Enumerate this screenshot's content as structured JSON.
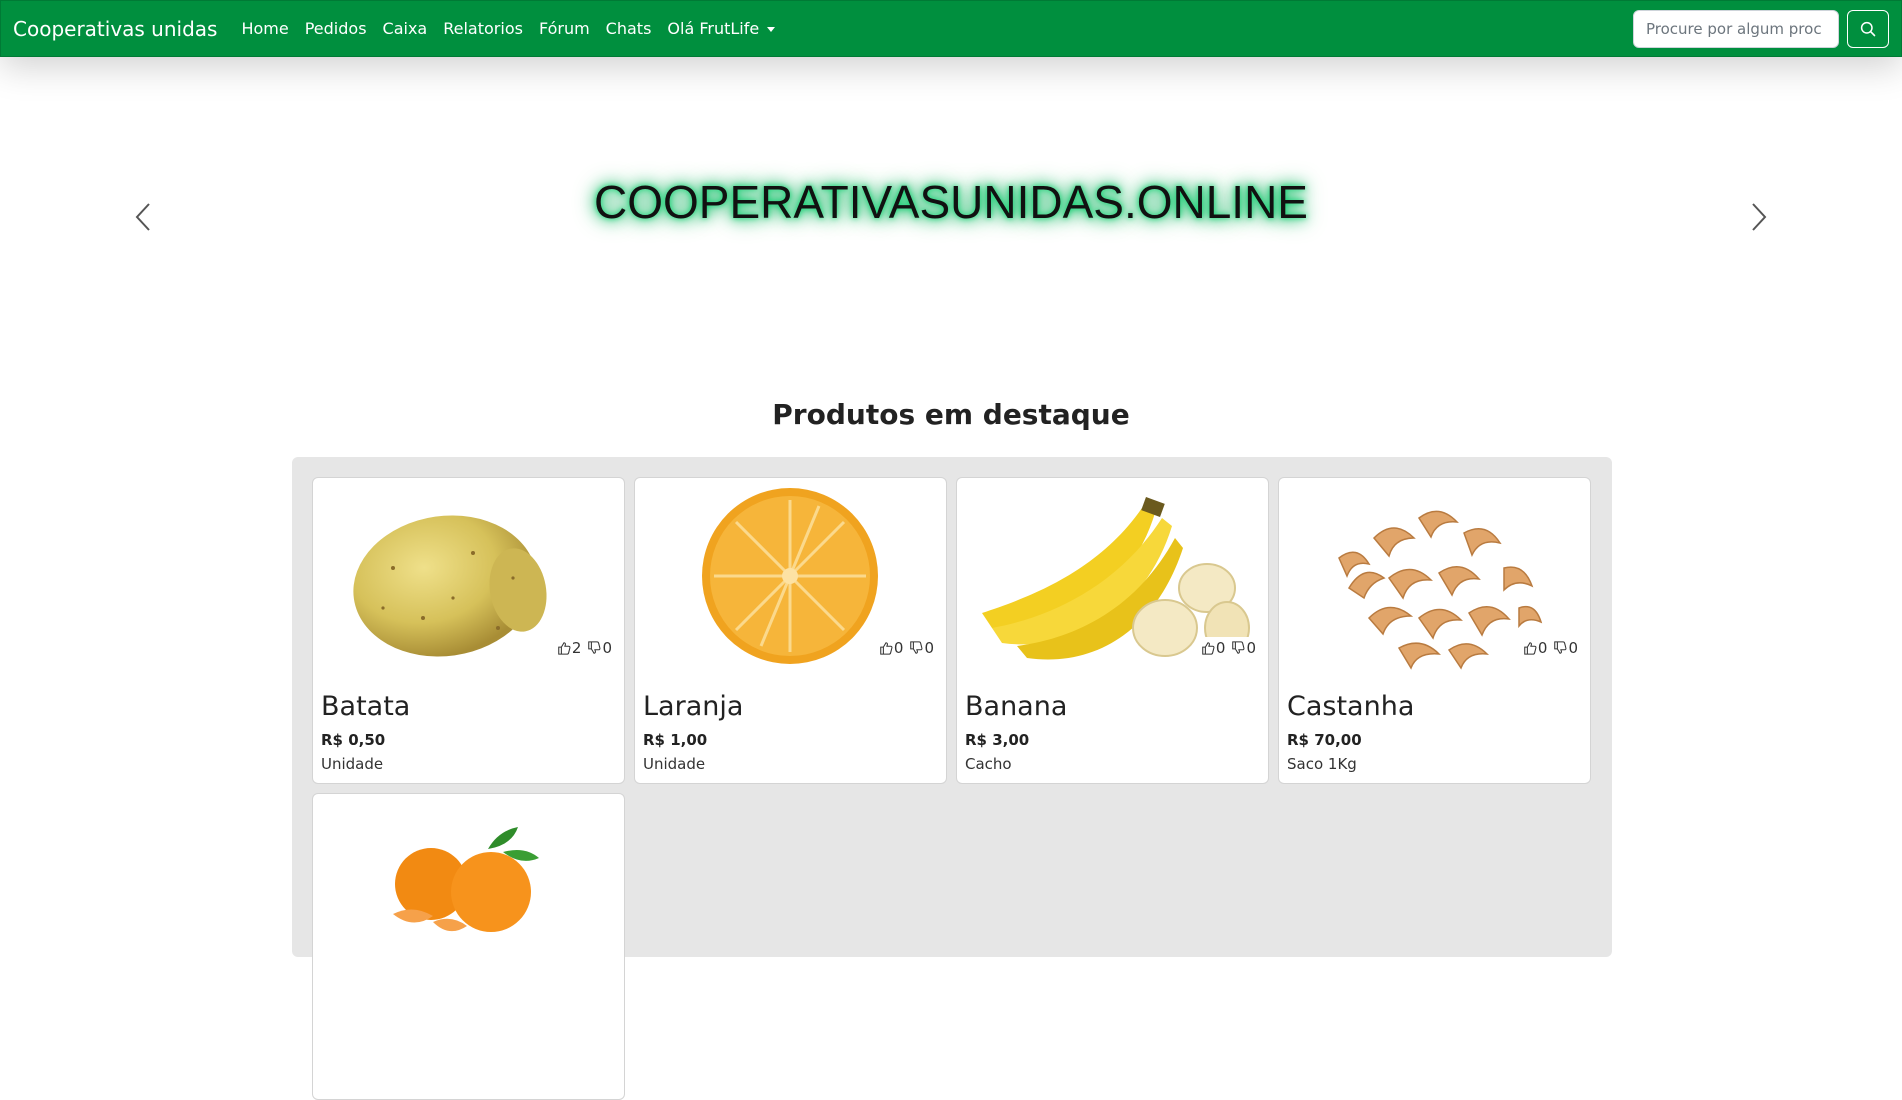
{
  "navbar": {
    "brand": "Cooperativas unidas",
    "links": [
      {
        "label": "Home"
      },
      {
        "label": "Pedidos"
      },
      {
        "label": "Caixa"
      },
      {
        "label": "Relatorios"
      },
      {
        "label": "Fórum"
      },
      {
        "label": "Chats"
      }
    ],
    "user_menu": "Olá FrutLife",
    "search": {
      "placeholder": "Procure por algum proc",
      "value": "",
      "icon": "search-icon"
    }
  },
  "hero": {
    "title": "COOPERATIVASUNIDAS.ONLINE",
    "prev_icon": "chevron-left-icon",
    "next_icon": "chevron-right-icon"
  },
  "featured": {
    "title": "Produtos em destaque",
    "products": [
      {
        "name": "Batata",
        "price": "R$ 0,50",
        "unit": "Unidade",
        "likes": "2",
        "dislikes": "0",
        "image": "potato"
      },
      {
        "name": "Laranja",
        "price": "R$ 1,00",
        "unit": "Unidade",
        "likes": "0",
        "dislikes": "0",
        "image": "orange"
      },
      {
        "name": "Banana",
        "price": "R$ 3,00",
        "unit": "Cacho",
        "likes": "0",
        "dislikes": "0",
        "image": "banana"
      },
      {
        "name": "Castanha",
        "price": "R$ 70,00",
        "unit": "Saco 1Kg",
        "likes": "0",
        "dislikes": "0",
        "image": "cashew"
      }
    ],
    "partial_product": {
      "image": "tangerine"
    }
  },
  "colors": {
    "navbar": "#008f3e",
    "panel": "#e6e6e6",
    "glow": "#00c060"
  }
}
